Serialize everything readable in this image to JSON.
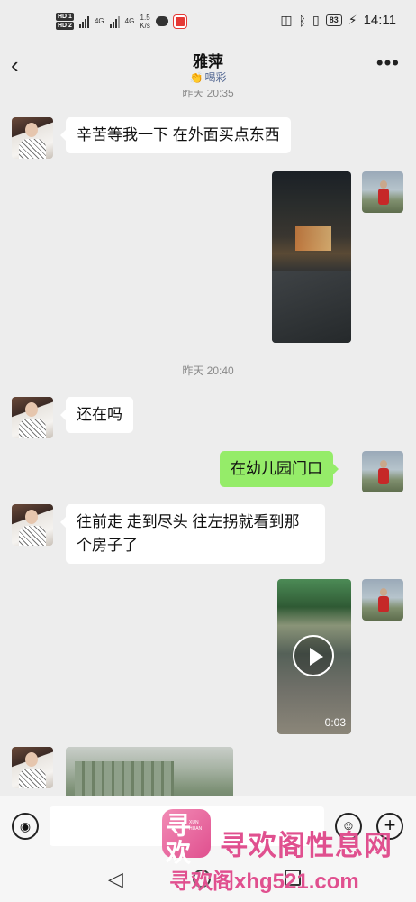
{
  "status_bar": {
    "hd1": "HD 1",
    "hd2": "HD 2",
    "net1": "4G",
    "net2": "4G",
    "speed_value": "1.5",
    "speed_unit": "K/s",
    "battery": "83",
    "time": "14:11"
  },
  "header": {
    "title": "雅萍",
    "subtitle": "喝彩"
  },
  "chat": {
    "timestamp_top_partial": "昨天 20:35",
    "timestamp_mid": "昨天 20:40",
    "messages": [
      {
        "side": "in",
        "type": "text",
        "text": "辛苦等我一下 在外面买点东西"
      },
      {
        "side": "out",
        "type": "image",
        "desc": "night-street-photo"
      },
      {
        "side": "in",
        "type": "text",
        "text": "还在吗"
      },
      {
        "side": "out",
        "type": "text",
        "text": "在幼儿园门口"
      },
      {
        "side": "in",
        "type": "text",
        "text": "往前走 走到尽头 往左拐就看到那个房子了"
      },
      {
        "side": "out",
        "type": "video",
        "duration": "0:03"
      },
      {
        "side": "in",
        "type": "image",
        "desc": "building-photo"
      }
    ]
  },
  "watermark": {
    "logo_glyph": "寻欢",
    "logo_en": "XUN HUAN",
    "name": "寻欢阁性息网",
    "url": "寻欢阁xhg521.com"
  },
  "colors": {
    "background": "#ededed",
    "bubble_out": "#95ec69",
    "bubble_in": "#ffffff",
    "subtitle": "#576b95",
    "watermark": "#e0508f"
  }
}
